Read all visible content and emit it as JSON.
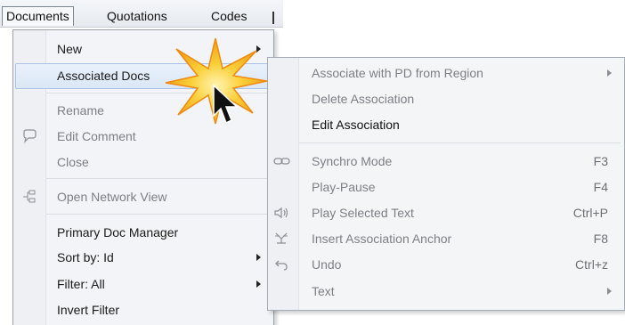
{
  "menubar": {
    "items": [
      {
        "label": "Documents"
      },
      {
        "label": "Quotations"
      },
      {
        "label": "Codes"
      }
    ]
  },
  "documents_menu": {
    "items": [
      {
        "label": "New",
        "has_submenu": true,
        "enabled": true
      },
      {
        "label": "Associated Docs",
        "has_submenu": true,
        "enabled": true,
        "highlighted": true
      },
      {
        "label": "Rename",
        "enabled": false
      },
      {
        "label": "Edit Comment",
        "enabled": false,
        "icon": "comment-bubble-icon"
      },
      {
        "label": "Close",
        "enabled": false
      },
      {
        "label": "Open Network View",
        "enabled": false,
        "icon": "network-icon"
      },
      {
        "label": "Primary Doc Manager",
        "enabled": true
      },
      {
        "label": "Sort by: Id",
        "has_submenu": true,
        "enabled": true
      },
      {
        "label": "Filter: All",
        "has_submenu": true,
        "enabled": true
      },
      {
        "label": "Invert Filter",
        "enabled": true
      }
    ]
  },
  "associated_docs_submenu": {
    "items": [
      {
        "label": "Associate with PD from Region",
        "has_submenu": true,
        "enabled": false
      },
      {
        "label": "Delete Association",
        "enabled": false
      },
      {
        "label": "Edit Association",
        "enabled": true
      },
      {
        "label": "Synchro Mode",
        "shortcut": "F3",
        "enabled": false,
        "icon": "chain-link-icon"
      },
      {
        "label": "Play-Pause",
        "shortcut": "F4",
        "enabled": false
      },
      {
        "label": "Play Selected Text",
        "shortcut": "Ctrl+P",
        "enabled": false,
        "icon": "speaker-icon"
      },
      {
        "label": "Insert Association Anchor",
        "shortcut": "F8",
        "enabled": false,
        "icon": "anchor-icon"
      },
      {
        "label": "Undo",
        "shortcut": "Ctrl+z",
        "enabled": false,
        "icon": "undo-icon"
      },
      {
        "label": "Text",
        "has_submenu": true,
        "enabled": false
      }
    ]
  },
  "colors": {
    "highlight": "#dbe7f6",
    "burst_fill": "#f6b41c",
    "disabled_text": "#7c7f85"
  }
}
